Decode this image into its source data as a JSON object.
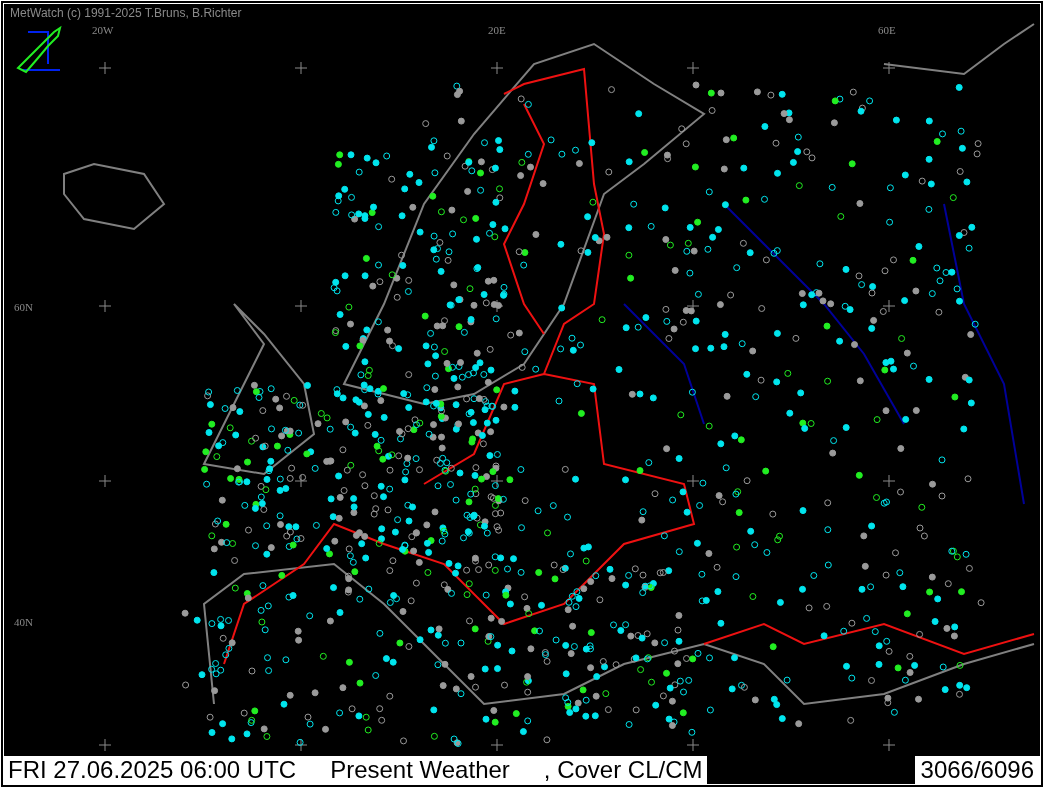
{
  "header": {
    "copyright": "MetWatch  (c) 1991-2025 T.Bruns, B.Richter"
  },
  "grid_labels": [
    {
      "text": "20W"
    },
    {
      "text": "20E"
    },
    {
      "text": "60E"
    },
    {
      "text": "60N"
    },
    {
      "text": "40N"
    }
  ],
  "status_bar": {
    "datetime": "FRI 27.06.2025 06:00 UTC",
    "parameter": "Present Weather",
    "overlay": ", Cover CL/CM",
    "count": "3066/6096"
  }
}
